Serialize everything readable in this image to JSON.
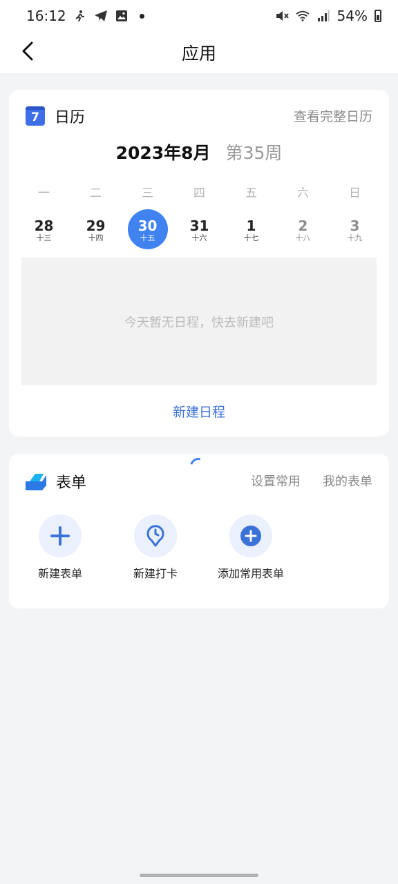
{
  "status_bar": {
    "time": "16:12",
    "battery": "54%"
  },
  "header": {
    "title": "应用"
  },
  "calendar": {
    "title": "日历",
    "icon_number": "7",
    "view_full_label": "查看完整日历",
    "month": "2023年8月",
    "week": "第35周",
    "weekdays": [
      "一",
      "二",
      "三",
      "四",
      "五",
      "六",
      "日"
    ],
    "dates": [
      {
        "num": "28",
        "lunar": "十三"
      },
      {
        "num": "29",
        "lunar": "十四"
      },
      {
        "num": "30",
        "lunar": "十五",
        "selected": true
      },
      {
        "num": "31",
        "lunar": "十六"
      },
      {
        "num": "1",
        "lunar": "十七"
      },
      {
        "num": "2",
        "lunar": "十八"
      },
      {
        "num": "3",
        "lunar": "十九"
      }
    ],
    "empty_text": "今天暂无日程，快去新建吧",
    "new_schedule_label": "新建日程"
  },
  "forms": {
    "title": "表单",
    "set_common_label": "设置常用",
    "my_forms_label": "我的表单",
    "tiles": [
      {
        "label": "新建表单",
        "icon": "plus-icon"
      },
      {
        "label": "新建打卡",
        "icon": "clock-pin-icon"
      },
      {
        "label": "添加常用表单",
        "icon": "add-circle-icon"
      }
    ]
  },
  "colors": {
    "accent": "#3f82f0",
    "link": "#3a72d8"
  }
}
